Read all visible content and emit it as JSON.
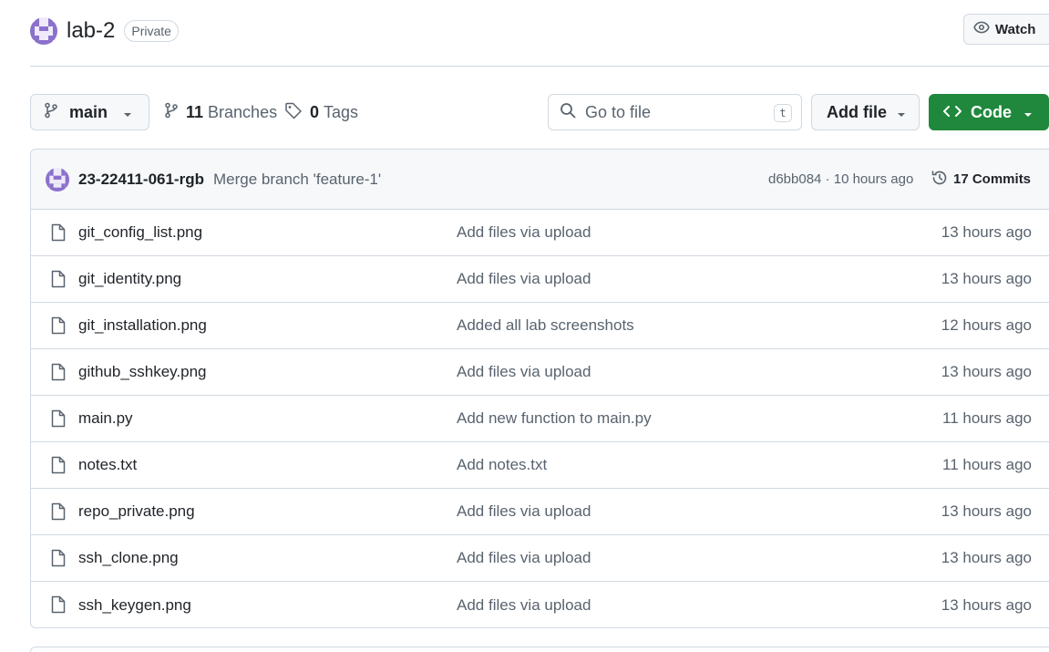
{
  "repo": {
    "name": "lab-2",
    "visibility": "Private",
    "watch_label": "Watch",
    "avatar_color": "#8b71cc"
  },
  "toolbar": {
    "branch_name": "main",
    "branches_count": "11",
    "branches_label": "Branches",
    "tags_count": "0",
    "tags_label": "Tags",
    "search_placeholder": "Go to file",
    "search_shortcut": "t",
    "add_file_label": "Add file",
    "code_label": "Code",
    "code_color": "#1f883d"
  },
  "latest_commit": {
    "author": "23-22411-061-rgb",
    "message": "Merge branch 'feature-1'",
    "sha_time": "d6bb084 · 10 hours ago",
    "commits_label": "17 Commits"
  },
  "files": [
    {
      "name": "git_config_list.png",
      "message": "Add files via upload",
      "date": "13 hours ago"
    },
    {
      "name": "git_identity.png",
      "message": "Add files via upload",
      "date": "13 hours ago"
    },
    {
      "name": "git_installation.png",
      "message": "Added all lab screenshots",
      "date": "12 hours ago"
    },
    {
      "name": "github_sshkey.png",
      "message": "Add files via upload",
      "date": "13 hours ago"
    },
    {
      "name": "main.py",
      "message": "Add new function to main.py",
      "date": "11 hours ago"
    },
    {
      "name": "notes.txt",
      "message": "Add notes.txt",
      "date": "11 hours ago"
    },
    {
      "name": "repo_private.png",
      "message": "Add files via upload",
      "date": "13 hours ago"
    },
    {
      "name": "ssh_clone.png",
      "message": "Add files via upload",
      "date": "13 hours ago"
    },
    {
      "name": "ssh_keygen.png",
      "message": "Add files via upload",
      "date": "13 hours ago"
    }
  ]
}
